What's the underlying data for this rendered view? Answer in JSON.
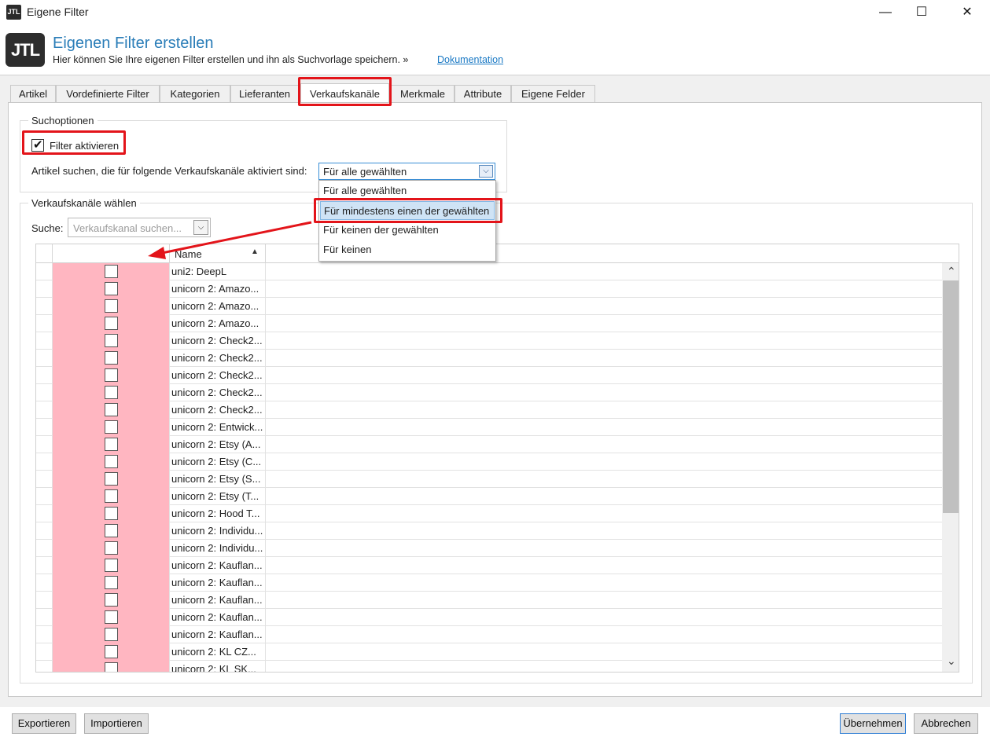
{
  "window": {
    "icon_text": "JTL",
    "title": "Eigene Filter",
    "minimize_glyph": "—",
    "maximize_glyph": "☐",
    "close_glyph": "✕"
  },
  "header": {
    "logo_text": "JTL",
    "title": "Eigenen Filter erstellen",
    "subtitle": "Hier können Sie Ihre eigenen Filter erstellen und ihn als Suchvorlage speichern. »",
    "doc_link": "Dokumentation"
  },
  "tabs": [
    {
      "label": "Artikel"
    },
    {
      "label": "Vordefinierte Filter"
    },
    {
      "label": "Kategorien"
    },
    {
      "label": "Lieferanten"
    },
    {
      "label": "Verkaufskanäle",
      "active": true
    },
    {
      "label": "Merkmale"
    },
    {
      "label": "Attribute"
    },
    {
      "label": "Eigene Felder"
    }
  ],
  "search_options": {
    "group_label": "Suchoptionen",
    "filter_checkbox_label": "Filter aktivieren",
    "filter_checked": true,
    "check_glyph": "✔",
    "mode_label": "Artikel suchen, die für folgende Verkaufskanäle aktiviert sind:",
    "mode_value": "Für alle gewählten",
    "dropdown_arrow_glyph": "⌵",
    "options": [
      "Für alle gewählten",
      "Für mindestens einen der gewählten",
      "Für keinen der gewählten",
      "Für keinen"
    ],
    "highlighted_option_index": 1
  },
  "channels": {
    "group_label": "Verkaufskanäle wählen",
    "search_label": "Suche:",
    "search_placeholder": "Verkaufskanal suchen...",
    "column_name": "Name",
    "sort_glyph": "▲",
    "scroll_up_glyph": "⌃",
    "scroll_down_glyph": "⌄",
    "rows": [
      "uni2: DeepL",
      "unicorn 2: Amazo...",
      "unicorn 2: Amazo...",
      "unicorn 2: Amazo...",
      "unicorn 2: Check2...",
      "unicorn 2: Check2...",
      "unicorn 2: Check2...",
      "unicorn 2: Check2...",
      "unicorn 2: Check2...",
      "unicorn 2: Entwick...",
      "unicorn 2: Etsy (A...",
      "unicorn 2: Etsy (C...",
      "unicorn 2: Etsy (S...",
      "unicorn 2: Etsy (T...",
      "unicorn 2: Hood T...",
      "unicorn 2: Individu...",
      "unicorn 2: Individu...",
      "unicorn 2: Kauflan...",
      "unicorn 2: Kauflan...",
      "unicorn 2: Kauflan...",
      "unicorn 2: Kauflan...",
      "unicorn 2: Kauflan...",
      "unicorn 2: KL CZ...",
      "unicorn 2: KL SK..."
    ]
  },
  "footer": {
    "export": "Exportieren",
    "import": "Importieren",
    "apply": "Übernehmen",
    "cancel": "Abbrechen"
  },
  "colors": {
    "accent": "#2a7db8",
    "highlight_red": "#e3141a",
    "checkbox_column_fill": "#ffb6c1",
    "selected_option_bg": "#cfe3f5"
  }
}
